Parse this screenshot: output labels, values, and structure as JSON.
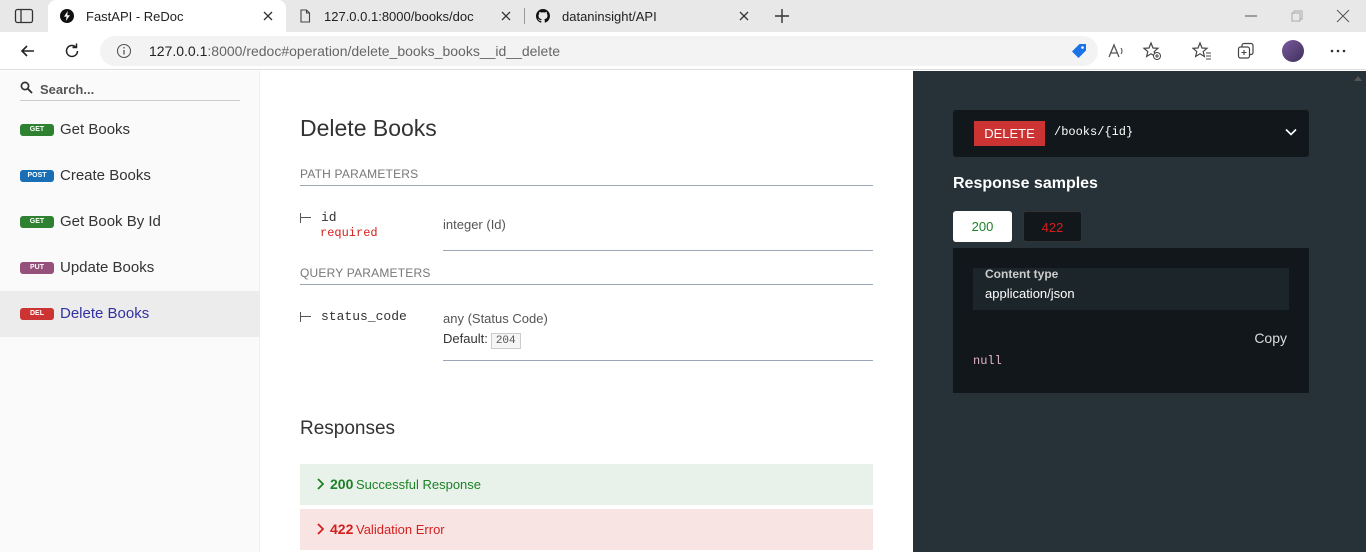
{
  "browser": {
    "tabs": [
      {
        "title": "FastAPI - ReDoc",
        "active": true,
        "icon": "lightning-icon"
      },
      {
        "title": "127.0.0.1:8000/books/doc",
        "active": false,
        "icon": "page-icon"
      },
      {
        "title": "dataninsight/API",
        "active": false,
        "icon": "github-icon"
      }
    ],
    "url_host": "127.0.0.1",
    "url_rest": ":8000/redoc#operation/delete_books_books__id__delete"
  },
  "sidebar": {
    "search_placeholder": "Search...",
    "items": [
      {
        "badge": "GET",
        "badge_color": "#2f8132",
        "label": "Get Books"
      },
      {
        "badge": "POST",
        "badge_color": "#186fb5",
        "label": "Create Books"
      },
      {
        "badge": "GET",
        "badge_color": "#2f8132",
        "label": "Get Book By Id"
      },
      {
        "badge": "PUT",
        "badge_color": "#95507c",
        "label": "Update Books"
      },
      {
        "badge": "DEL",
        "badge_color": "#cc3333",
        "label": "Delete Books",
        "active": true
      }
    ]
  },
  "operation": {
    "title": "Delete Books",
    "path_params_heading": "PATH PARAMETERS",
    "path_param": {
      "name": "id",
      "required": "required",
      "type": "integer (Id)"
    },
    "query_params_heading": "QUERY PARAMETERS",
    "query_param": {
      "name": "status_code",
      "type": "any (Status Code)",
      "default_label": "Default:",
      "default_value": "204"
    },
    "responses_heading": "Responses",
    "responses": [
      {
        "code": "200",
        "description": "Successful Response"
      },
      {
        "code": "422",
        "description": "Validation Error"
      }
    ]
  },
  "right_panel": {
    "method": "DELETE",
    "path": "/books/{id}",
    "samples_heading": "Response samples",
    "sample_tabs": [
      "200",
      "422"
    ],
    "content_type_label": "Content type",
    "content_type_value": "application/json",
    "copy_label": "Copy",
    "body": "null"
  },
  "colors": {
    "delete": "#cc3333",
    "success": "#1d8127",
    "error": "#d41f1c",
    "active_link": "#32329f",
    "right_bg": "#263238"
  }
}
